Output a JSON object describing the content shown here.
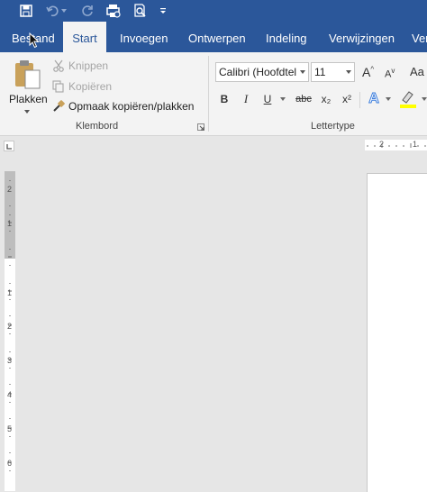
{
  "qat": {
    "icons": [
      "save-icon",
      "undo-icon",
      "redo-icon",
      "print-preview-icon",
      "search-document-icon",
      "customize-qat-icon"
    ]
  },
  "tabs": [
    "Bestand",
    "Start",
    "Invoegen",
    "Ontwerpen",
    "Indeling",
    "Verwijzingen",
    "Ver"
  ],
  "active_tab": "Start",
  "clipboard": {
    "paste_label": "Plakken",
    "cut_label": "Knippen",
    "copy_label": "Kopiëren",
    "format_painter_label": "Opmaak kopiëren/plakken",
    "group_label": "Klembord"
  },
  "font": {
    "font_name": "Calibri (Hoofdtel",
    "font_size": "11",
    "grow_label": "A",
    "shrink_label": "A",
    "change_case_label": "Aa",
    "bold": "B",
    "italic": "I",
    "underline": "U",
    "strikethrough": "abc",
    "subscript": "x₂",
    "superscript": "x²",
    "text_effects": "A",
    "group_label": "Lettertype"
  },
  "ruler": {
    "horizontal_labels": [
      "2",
      "1"
    ],
    "vertical_labels": [
      "2",
      "1",
      "1",
      "2",
      "3",
      "4",
      "5",
      "6"
    ]
  },
  "colors": {
    "title_bar": "#2b579a",
    "ribbon": "#f3f3f3",
    "workspace": "#e6e6e6",
    "highlight": "#ffff00"
  }
}
